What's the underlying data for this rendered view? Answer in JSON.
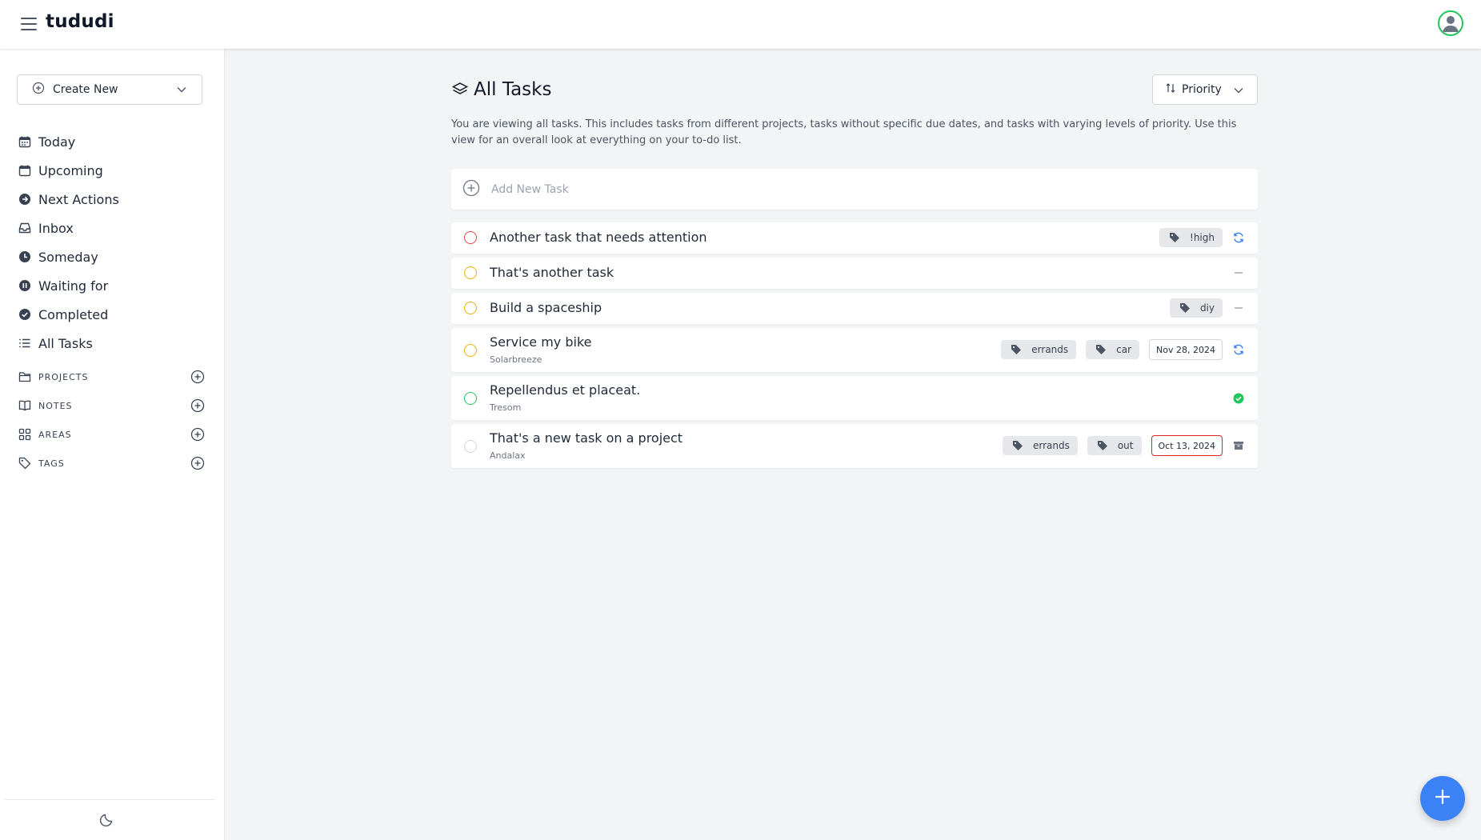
{
  "app": {
    "title": "tududi"
  },
  "sidebar": {
    "create_new": "Create New",
    "nav": [
      {
        "label": "Today",
        "icon": "calendar-icon"
      },
      {
        "label": "Upcoming",
        "icon": "calendar-icon"
      },
      {
        "label": "Next Actions",
        "icon": "arrow-circle-icon"
      },
      {
        "label": "Inbox",
        "icon": "inbox-icon"
      },
      {
        "label": "Someday",
        "icon": "clock-icon"
      },
      {
        "label": "Waiting for",
        "icon": "pause-icon"
      },
      {
        "label": "Completed",
        "icon": "check-circle-icon"
      },
      {
        "label": "All Tasks",
        "icon": "list-icon"
      }
    ],
    "sections": [
      {
        "label": "PROJECTS",
        "icon": "folder-icon"
      },
      {
        "label": "NOTES",
        "icon": "book-icon"
      },
      {
        "label": "AREAS",
        "icon": "grid-icon"
      },
      {
        "label": "TAGS",
        "icon": "tag-icon"
      }
    ]
  },
  "main": {
    "title": "All Tasks",
    "sort_label": "Priority",
    "description": "You are viewing all tasks. This includes tasks from different projects, tasks without specific due dates, and tasks with varying levels of priority. Use this view for an overall look at everything on your to-do list.",
    "add_task_placeholder": "Add New Task",
    "tasks": [
      {
        "name": "Another task that needs attention",
        "project": "",
        "tags": [
          "!high"
        ],
        "date": "",
        "status": "recurring",
        "priority_color": "#ef4444"
      },
      {
        "name": "That's another task",
        "project": "",
        "tags": [],
        "date": "",
        "status": "not-started",
        "priority_color": "#eab308"
      },
      {
        "name": "Build a spaceship",
        "project": "",
        "tags": [
          "diy"
        ],
        "date": "",
        "status": "not-started",
        "priority_color": "#eab308"
      },
      {
        "name": "Service my bike",
        "project": "Solarbreeze",
        "tags": [
          "errands",
          "car"
        ],
        "date": "Nov 28, 2024",
        "status": "recurring",
        "priority_color": "#eab308"
      },
      {
        "name": "Repellendus et placeat.",
        "project": "Tresom",
        "tags": [],
        "date": "",
        "status": "done",
        "priority_color": "#22c55e"
      },
      {
        "name": "That's a new task on a project",
        "project": "Andalax",
        "tags": [
          "errands",
          "out"
        ],
        "date": "Oct 13, 2024",
        "date_overdue": true,
        "status": "archived",
        "priority_color": "#d1d5db"
      }
    ]
  },
  "colors": {
    "accent": "#3b82f6",
    "success": "#22c55e",
    "danger": "#dc2626"
  }
}
